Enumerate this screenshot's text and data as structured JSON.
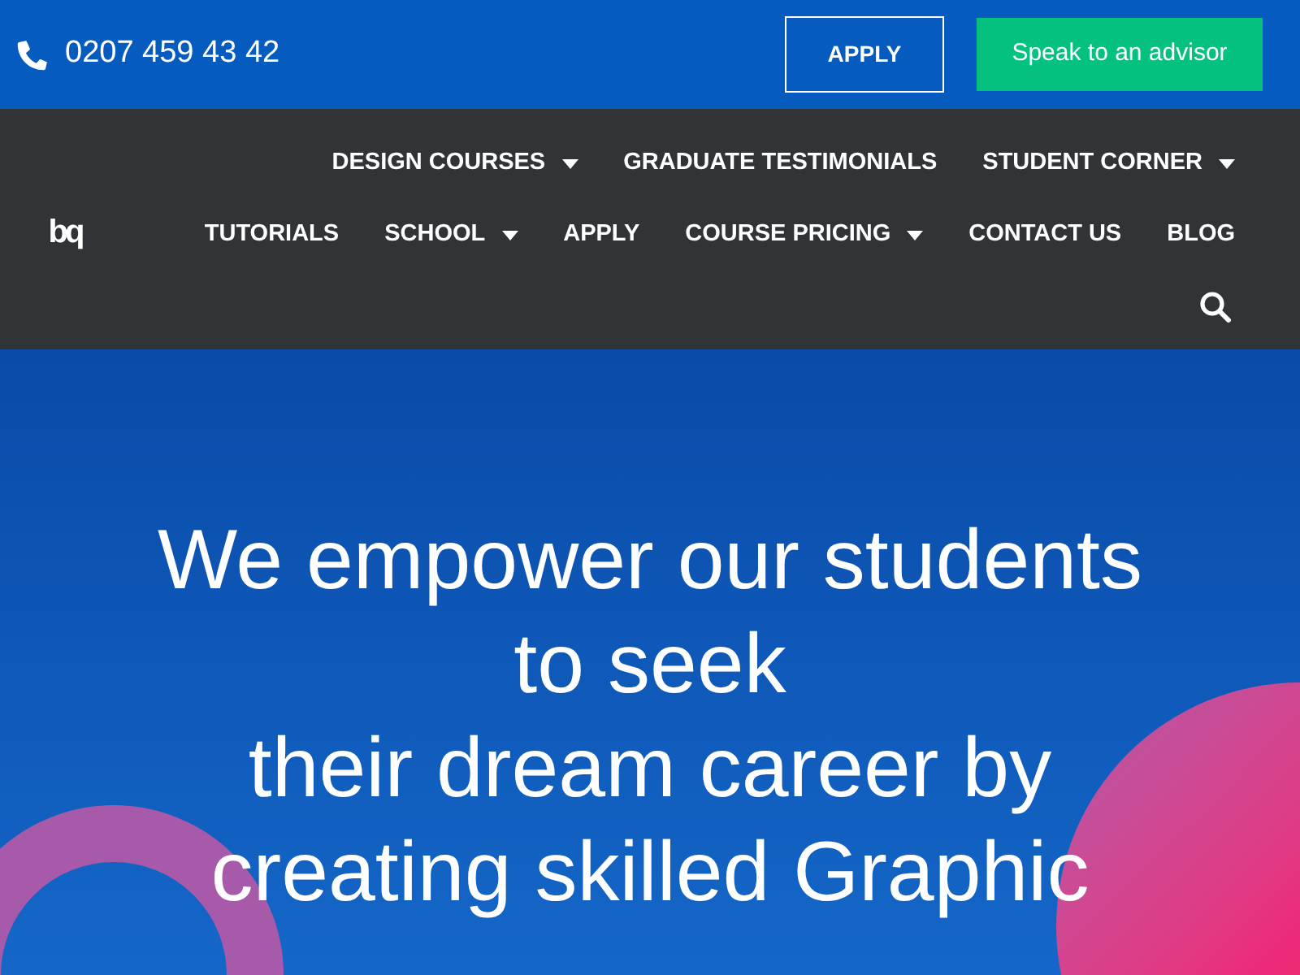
{
  "top_bar": {
    "phone": "0207 459 43 42",
    "apply_button": "APPLY",
    "advisor_button": "Speak to an advisor"
  },
  "logo": "bq",
  "nav_rows": [
    [
      {
        "label": "DESIGN COURSES",
        "dropdown": true
      },
      {
        "label": "GRADUATE TESTIMONIALS",
        "dropdown": false
      },
      {
        "label": "STUDENT CORNER",
        "dropdown": true
      }
    ],
    [
      {
        "label": "TUTORIALS",
        "dropdown": false
      },
      {
        "label": "SCHOOL",
        "dropdown": true
      },
      {
        "label": "APPLY",
        "dropdown": false
      },
      {
        "label": "COURSE PRICING",
        "dropdown": true
      },
      {
        "label": "CONTACT US",
        "dropdown": false
      },
      {
        "label": "BLOG",
        "dropdown": false
      }
    ]
  ],
  "hero": {
    "headline_lines": [
      "We empower our students",
      "to seek",
      "their dream career by",
      "creating skilled Graphic"
    ]
  }
}
